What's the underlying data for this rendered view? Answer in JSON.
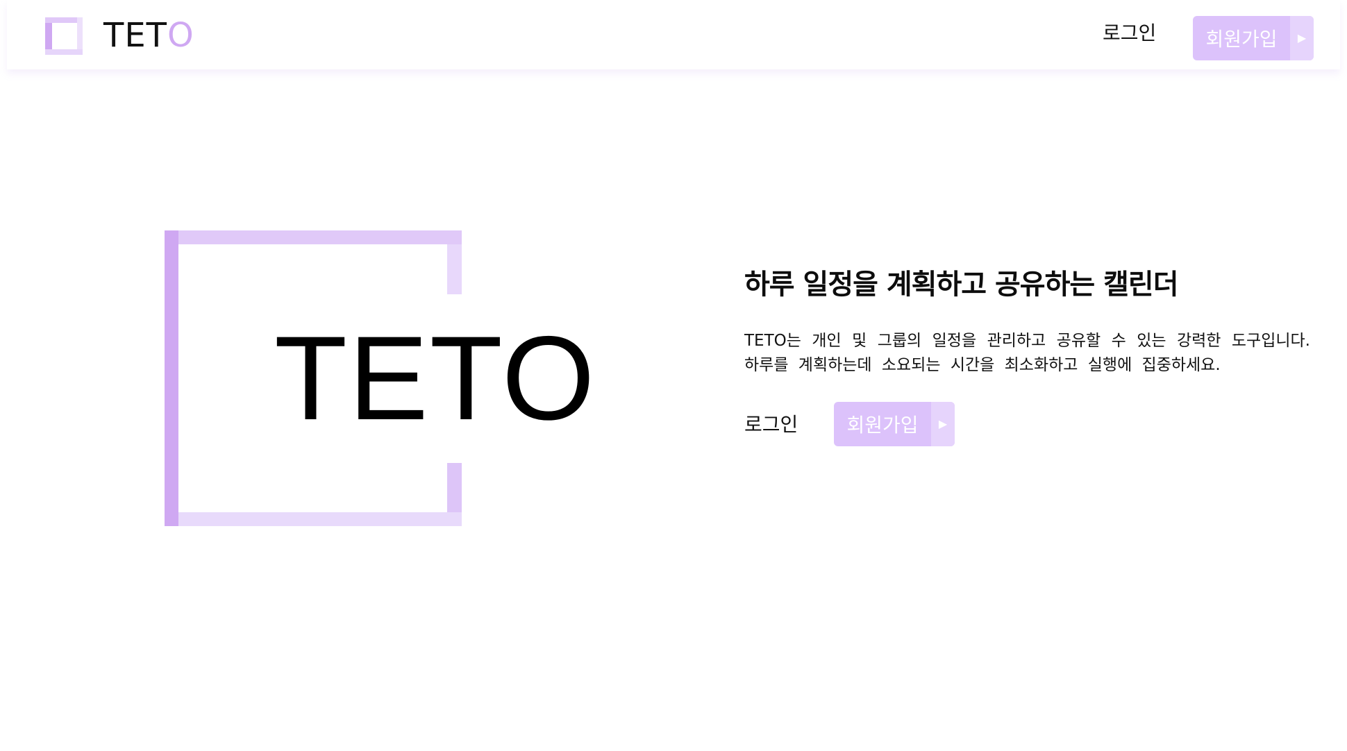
{
  "header": {
    "logo_text_main": "TET",
    "logo_text_accent": "O",
    "login_label": "로그인",
    "signup_label": "회원가입",
    "signup_arrow": "▶"
  },
  "hero": {
    "wordmark": "TETO",
    "title": "하루 일정을 계획하고 공유하는 캘린더",
    "description": "TETO는 개인 및 그룹의 일정을 관리하고 공유할 수 있는 강력한 도구입니다. 하루를 계획하는데 소요되는 시간을 최소화하고 실행에 집중하세요.",
    "login_label": "로그인",
    "signup_label": "회원가입",
    "signup_arrow": "▶"
  },
  "colors": {
    "accent": "#cfa8f2",
    "accent_light": "#e0c9f8",
    "button_bg": "#dcc2fb",
    "button_arrow_bg": "#e6d4fc"
  },
  "icons": {
    "logo": "teto-logo-icon",
    "signup_arrow": "play-arrow-icon"
  }
}
